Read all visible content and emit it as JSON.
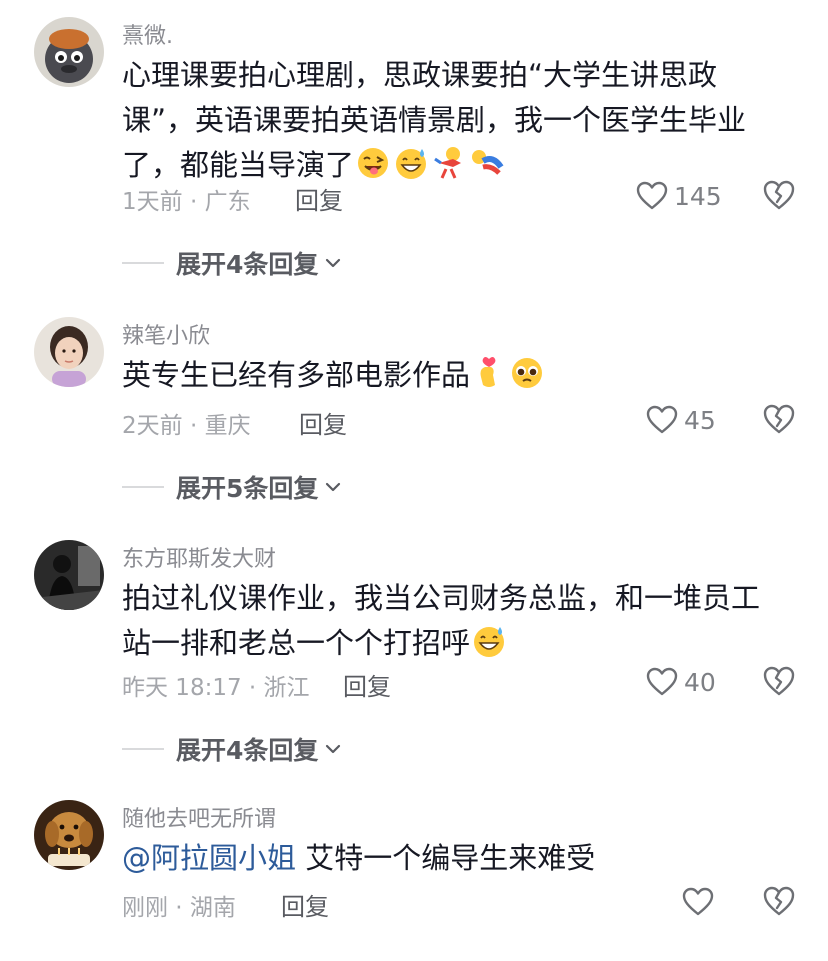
{
  "comments": [
    {
      "username": "熹微.",
      "text_line1": "心理课要拍心理剧，思政课要拍“大学生讲思政",
      "text_line2": "课”，英语课要拍英语情景剧，我一个医学生毕业",
      "text_line3": "了，都能当导演了",
      "meta": "1天前 · 广东",
      "reply_label": "回复",
      "likes": "145",
      "expand_label": "展开4条回复"
    },
    {
      "username": "辣笔小欣",
      "text_line1": "英专生已经有多部电影作品",
      "meta": "2天前 · 重庆",
      "reply_label": "回复",
      "likes": "45",
      "expand_label": "展开5条回复"
    },
    {
      "username": "东方耶斯发大财",
      "text_line1": "拍过礼仪课作业，我当公司财务总监，和一堆员工",
      "text_line2": "站一排和老总一个个打招呼",
      "meta": "昨天 18:17 · 浙江",
      "reply_label": "回复",
      "likes": "40",
      "expand_label": "展开4条回复"
    },
    {
      "username": "随他去吧无所谓",
      "mention": "@阿拉圆小姐",
      "text_line1": " 艾特一个编导生来难受",
      "meta": "刚刚 · 湖南",
      "reply_label": "回复"
    }
  ],
  "icons": {
    "like": "heart-outline-icon",
    "dislike": "broken-heart-icon",
    "expand": "chevron-down-icon",
    "emoji_wink": "wink-tongue-emoji",
    "emoji_sweat": "grinning-sweat-emoji",
    "emoji_heart_hands": "finger-heart-emoji",
    "emoji_pleading": "pleading-face-emoji"
  },
  "colors": {
    "mention": "#2d5b9a",
    "username": "#8a8b91",
    "meta": "#a4a6ab"
  }
}
